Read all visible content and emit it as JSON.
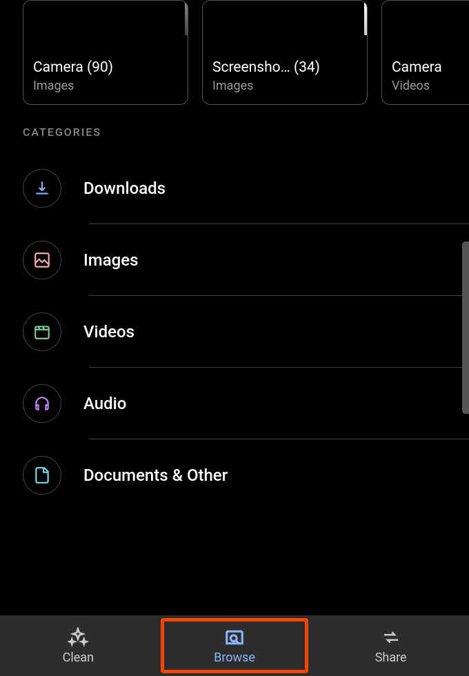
{
  "folders": [
    {
      "title": "Camera (90)",
      "subtitle": "Images"
    },
    {
      "title": "Screensho… (34)",
      "subtitle": "Images"
    },
    {
      "title": "Camera",
      "subtitle": "Videos"
    }
  ],
  "section_header": "CATEGORIES",
  "categories": [
    {
      "label": "Downloads",
      "icon": "download"
    },
    {
      "label": "Images",
      "icon": "image"
    },
    {
      "label": "Videos",
      "icon": "video"
    },
    {
      "label": "Audio",
      "icon": "audio"
    },
    {
      "label": "Documents & Other",
      "icon": "document"
    }
  ],
  "nav": [
    {
      "label": "Clean",
      "icon": "sparkle",
      "active": false
    },
    {
      "label": "Browse",
      "icon": "browse",
      "active": true
    },
    {
      "label": "Share",
      "icon": "share",
      "active": false
    }
  ]
}
